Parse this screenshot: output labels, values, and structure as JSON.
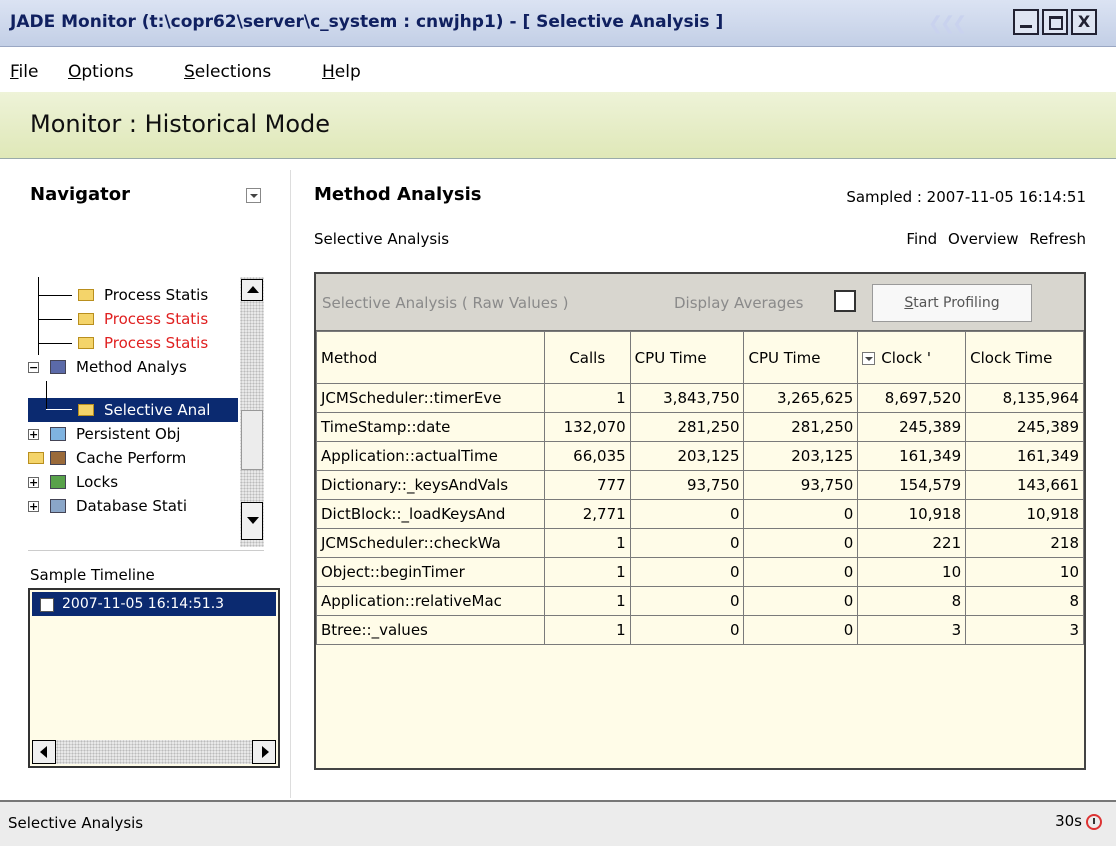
{
  "window": {
    "title": "JADE Monitor (t:\\copr62\\server\\c_system : cnwjhp1) - [ Selective Analysis ]",
    "close_glyph": "X"
  },
  "menu": [
    {
      "label": "File",
      "mnemonic": "F",
      "rest": "ile"
    },
    {
      "label": "Options",
      "mnemonic": "O",
      "rest": "ptions"
    },
    {
      "label": "Selections",
      "mnemonic": "S",
      "rest": "elections"
    },
    {
      "label": "Help",
      "mnemonic": "H",
      "rest": "elp"
    }
  ],
  "banner": {
    "title": "Monitor : Historical Mode"
  },
  "navigator": {
    "title": "Navigator",
    "items": [
      {
        "label": "Process Statis",
        "icon": "folder-icon",
        "color": "#000000"
      },
      {
        "label": "Process Statis",
        "icon": "folder-icon",
        "color": "#e02020"
      },
      {
        "label": "Process Statis",
        "icon": "folder-icon",
        "color": "#e02020"
      },
      {
        "label": "Method Analys",
        "icon": "method-analysis-icon",
        "color": "#000000"
      },
      {
        "label": "Selective Anal",
        "icon": "folder-icon",
        "color": "#ffffff"
      },
      {
        "label": "Persistent Obj",
        "icon": "persistent-objects-icon",
        "color": "#000000"
      },
      {
        "label": "Cache Perform",
        "icon": "cache-icon",
        "color": "#000000"
      },
      {
        "label": "Locks",
        "icon": "locks-icon",
        "color": "#000000"
      },
      {
        "label": "Database Stati",
        "icon": "database-icon",
        "color": "#000000"
      }
    ],
    "selected_index": 4
  },
  "timeline": {
    "label": "Sample Timeline",
    "items": [
      "2007-11-05 16:14:51.3"
    ]
  },
  "main": {
    "title": "Method Analysis",
    "sampled": "Sampled : 2007-11-05 16:14:51",
    "subtitle": "Selective Analysis",
    "links": [
      "Find",
      "Overview",
      "Refresh"
    ]
  },
  "panel": {
    "caption": "Selective Analysis  ( Raw Values )",
    "averages_label": "Display Averages",
    "averages_checked": false,
    "start_button": "Start Profiling"
  },
  "table": {
    "columns": [
      "Method",
      "Calls",
      "CPU Time",
      "CPU Time",
      "Clock '",
      "Clock Time"
    ],
    "rows": [
      [
        "JCMScheduler::timerEve",
        "1",
        "3,843,750",
        "3,265,625",
        "8,697,520",
        "8,135,964"
      ],
      [
        "TimeStamp::date",
        "132,070",
        "281,250",
        "281,250",
        "245,389",
        "245,389"
      ],
      [
        "Application::actualTime",
        "66,035",
        "203,125",
        "203,125",
        "161,349",
        "161,349"
      ],
      [
        "Dictionary::_keysAndVals",
        "777",
        "93,750",
        "93,750",
        "154,579",
        "143,661"
      ],
      [
        "DictBlock::_loadKeysAnd",
        "2,771",
        "0",
        "0",
        "10,918",
        "10,918"
      ],
      [
        "JCMScheduler::checkWa",
        "1",
        "0",
        "0",
        "221",
        "218"
      ],
      [
        "Object::beginTimer",
        "1",
        "0",
        "0",
        "10",
        "10"
      ],
      [
        "Application::relativeMac",
        "1",
        "0",
        "0",
        "8",
        "8"
      ],
      [
        "Btree::_values",
        "1",
        "0",
        "0",
        "3",
        "3"
      ]
    ]
  },
  "status": {
    "left": "Selective Analysis",
    "right": "30s"
  }
}
